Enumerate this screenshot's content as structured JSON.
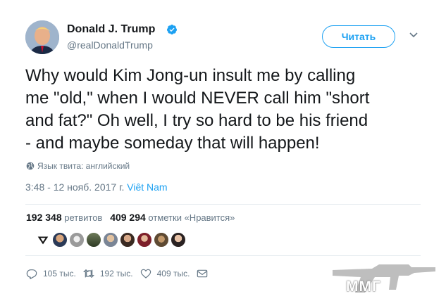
{
  "author": {
    "display_name": "Donald J. Trump",
    "username": "@realDonaldTrump"
  },
  "header": {
    "follow_label": "Читать"
  },
  "tweet": {
    "text": "Why would Kim Jong-un insult me by calling\nme \"old,\" when I would NEVER call him \"short\nand fat?\" Oh well, I try so hard to be his friend\n- and maybe someday that will happen!",
    "language_note": "Язык твита: английский",
    "timestamp": "3:48 - 12 нояб. 2017 г.",
    "location": "Viêt Nam"
  },
  "stats": {
    "retweets_count": "192 348",
    "retweets_label": "ретвитов",
    "likes_count": "409 294",
    "likes_label": "отметки «Нравится»"
  },
  "actions": {
    "reply_count": "105 тыс.",
    "retweet_count": "192 тыс.",
    "like_count": "409 тыс."
  },
  "watermark": {
    "text": "ММГ"
  },
  "colors": {
    "accent": "#1da1f2",
    "text": "#14171a",
    "muted": "#657786",
    "divider": "#e6ecf0"
  },
  "icons": [
    "verified-icon",
    "chevron-down-icon",
    "globe-icon",
    "reply-icon",
    "retweet-icon",
    "like-icon",
    "message-icon"
  ]
}
